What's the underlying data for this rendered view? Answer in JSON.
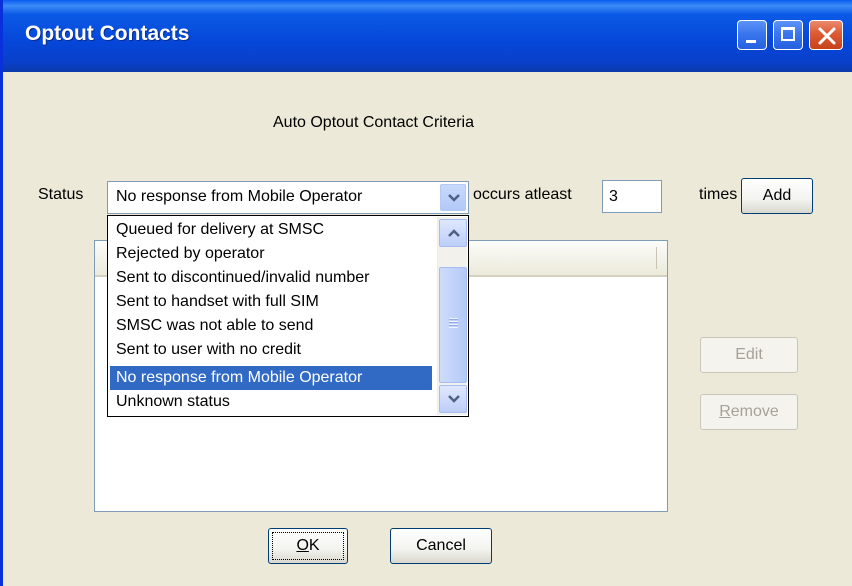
{
  "window": {
    "title": "Optout Contacts"
  },
  "criteria": {
    "heading": "Auto Optout Contact Criteria",
    "status_label": "Status",
    "status_value": "No response from Mobile Operator",
    "occurs_label": "occurs atleast",
    "count_value": "3",
    "times_label": "times",
    "add_label": "Add"
  },
  "dropdown": {
    "options": [
      "Queued for delivery at SMSC",
      "Rejected by operator",
      "Sent to discontinued/invalid number",
      "Sent to handset with full SIM",
      "SMSC was not able to send",
      "Sent to user with no credit",
      "No response from Mobile Operator",
      "Unknown status"
    ],
    "selected_index": 6
  },
  "side_buttons": {
    "edit_label": "Edit",
    "remove_label": "Remove"
  },
  "footer": {
    "ok_label": "OK",
    "cancel_label": "Cancel"
  },
  "colors": {
    "selection": "#316ac5",
    "titlebar": "#0546d8",
    "dialog_bg": "#ece9d8"
  },
  "icons": {
    "close": "close-icon",
    "minimize": "minimize-icon",
    "maximize": "maximize-icon",
    "combo_arrow": "chevron-down-icon",
    "scroll_up": "chevron-up-icon",
    "scroll_down": "chevron-down-icon"
  }
}
